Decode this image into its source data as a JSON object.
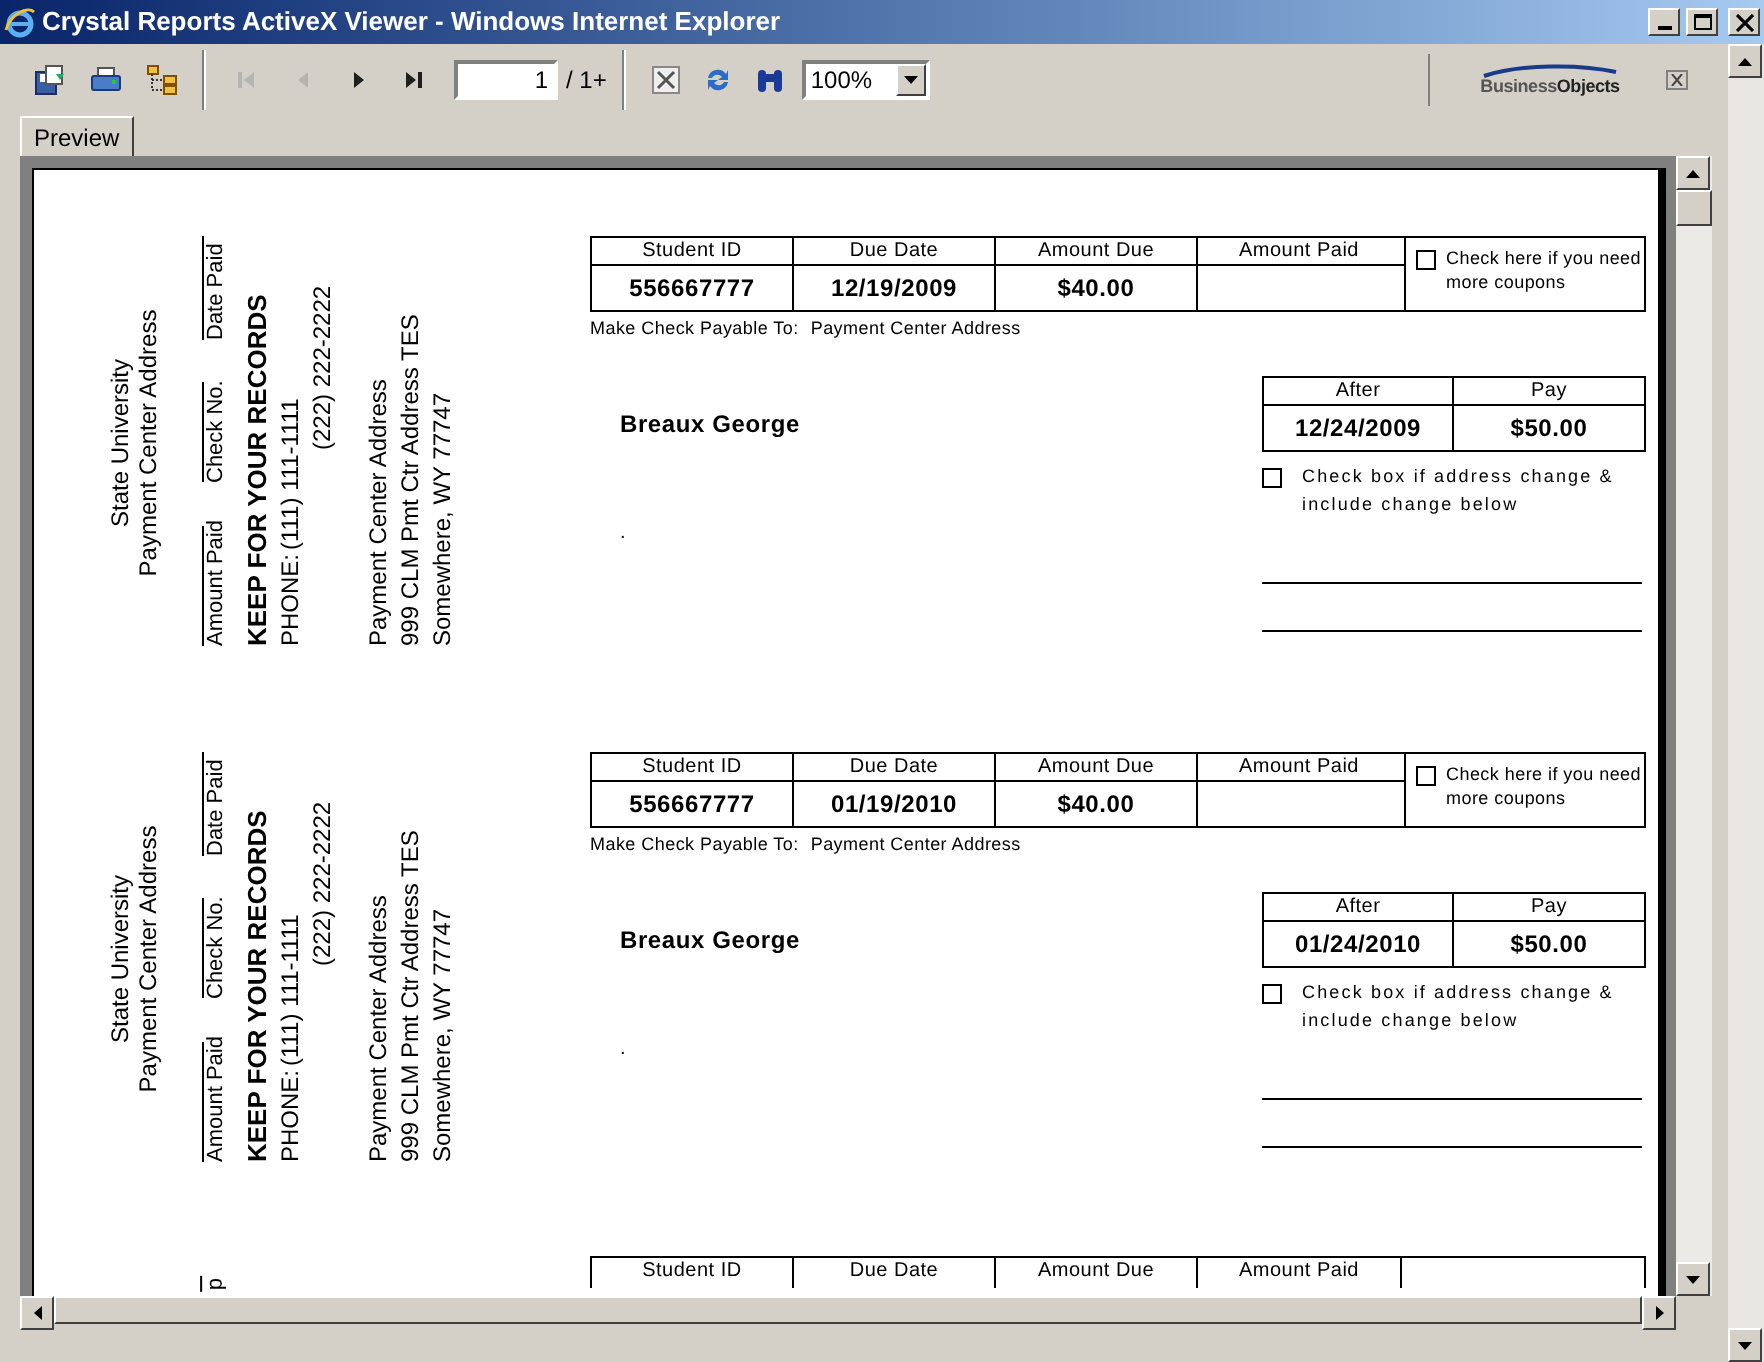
{
  "window": {
    "title": "Crystal Reports ActiveX Viewer - Windows Internet Explorer"
  },
  "toolbar": {
    "groups": [
      [
        {
          "kind": "export",
          "disabled": false
        },
        {
          "kind": "print",
          "disabled": false
        },
        {
          "kind": "tree",
          "disabled": false
        }
      ],
      [
        {
          "kind": "first",
          "disabled": true
        },
        {
          "kind": "prev",
          "disabled": true
        },
        {
          "kind": "next",
          "disabled": false
        },
        {
          "kind": "last",
          "disabled": false
        }
      ]
    ],
    "page_field": {
      "value": "1"
    },
    "page_total": "/ 1+",
    "tools": [
      {
        "kind": "stop",
        "disabled": false
      },
      {
        "kind": "refresh",
        "disabled": false
      },
      {
        "kind": "search",
        "disabled": false
      }
    ],
    "zoom": {
      "value": "100%"
    },
    "logo": {
      "part_1": "Business",
      "part_2": "Objects"
    }
  },
  "tabs": [
    {
      "label": "Preview",
      "selected": true
    }
  ],
  "coupons": [
    {
      "kind": "full",
      "stub": {
        "school": "State University",
        "address_title": "Payment Center Address",
        "fields": [
          "Amount Paid",
          "Check No.",
          "Date Paid"
        ],
        "notice": "KEEP FOR YOUR RECORDS",
        "phone_label": "PHONE:",
        "phones": [
          "(111) 111-1111",
          "(222) 222-2222"
        ],
        "mail_lines": [
          "Payment Center Address",
          "999 CLM Pmt Ctr Address TES",
          "Somewhere, WY 77747"
        ]
      },
      "columns": [
        "Student ID",
        "Due Date",
        "Amount Due",
        "Amount Paid"
      ],
      "values": [
        "556667777",
        "12/19/2009",
        "$40.00"
      ],
      "more_coupons": {
        "checked": false,
        "label": "Check here if you need more coupons"
      },
      "payable_label": "Make Check Payable To:",
      "payable_to": "Payment Center Address",
      "payer": "Breaux George",
      "address_line": ".",
      "late": {
        "columns": [
          "After",
          "Pay"
        ],
        "values": [
          "12/24/2009",
          "$50.00"
        ]
      },
      "address_change": {
        "checked": false,
        "label": "Check box if address change & include change below"
      }
    },
    {
      "kind": "full",
      "stub": {
        "school": "State University",
        "address_title": "Payment Center Address",
        "fields": [
          "Amount Paid",
          "Check No.",
          "Date Paid"
        ],
        "notice": "KEEP FOR YOUR RECORDS",
        "phone_label": "PHONE:",
        "phones": [
          "(111) 111-1111",
          "(222) 222-2222"
        ],
        "mail_lines": [
          "Payment Center Address",
          "999 CLM Pmt Ctr Address TES",
          "Somewhere, WY 77747"
        ]
      },
      "columns": [
        "Student ID",
        "Due Date",
        "Amount Due",
        "Amount Paid"
      ],
      "values": [
        "556667777",
        "01/19/2010",
        "$40.00"
      ],
      "more_coupons": {
        "checked": false,
        "label": "Check here if you need more coupons"
      },
      "payable_label": "Make Check Payable To:",
      "payable_to": "Payment Center Address",
      "payer": "Breaux George",
      "address_line": ".",
      "late": {
        "columns": [
          "After",
          "Pay"
        ],
        "values": [
          "01/24/2010",
          "$50.00"
        ]
      },
      "address_change": {
        "checked": false,
        "label": "Check box if address change & include change below"
      }
    },
    {
      "kind": "partial",
      "stub_fragment": "d",
      "columns": [
        "Student ID",
        "Due Date",
        "Amount Due",
        "Amount Paid"
      ]
    }
  ]
}
